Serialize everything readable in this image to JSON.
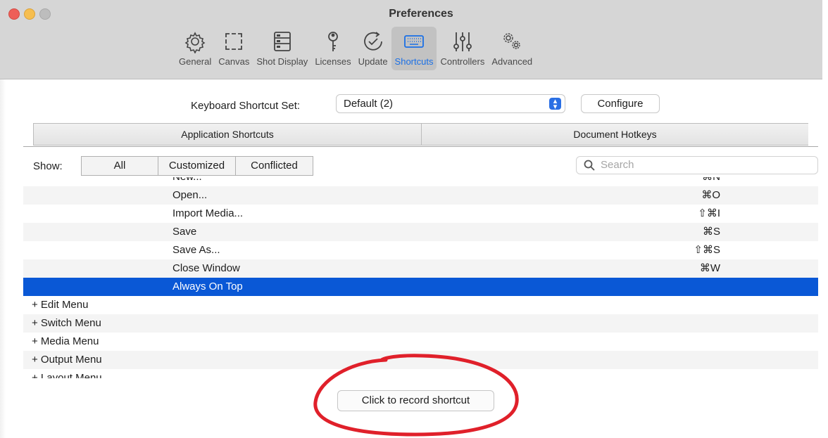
{
  "window": {
    "title": "Preferences"
  },
  "toolbar": {
    "items": [
      {
        "label": "General",
        "icon": "gear-icon"
      },
      {
        "label": "Canvas",
        "icon": "canvas-icon"
      },
      {
        "label": "Shot Display",
        "icon": "shot-display-icon"
      },
      {
        "label": "Licenses",
        "icon": "key-icon"
      },
      {
        "label": "Update",
        "icon": "update-check-icon"
      },
      {
        "label": "Shortcuts",
        "icon": "keyboard-icon",
        "selected": true
      },
      {
        "label": "Controllers",
        "icon": "sliders-icon"
      },
      {
        "label": "Advanced",
        "icon": "gears-icon"
      }
    ]
  },
  "shortcut_set": {
    "label": "Keyboard Shortcut Set:",
    "selected": "Default (2)",
    "configure_label": "Configure"
  },
  "tabs": [
    {
      "label": "Application Shortcuts",
      "selected": true
    },
    {
      "label": "Document Hotkeys",
      "selected": false
    }
  ],
  "filter": {
    "show_label": "Show:",
    "options": [
      "All",
      "Customized",
      "Conflicted"
    ],
    "selected": "All"
  },
  "search": {
    "placeholder": "Search"
  },
  "shortcuts": [
    {
      "name": "New...",
      "key": "⌘N"
    },
    {
      "name": "Open...",
      "key": "⌘O"
    },
    {
      "name": "Import Media...",
      "key": "⇧⌘I"
    },
    {
      "name": "Save",
      "key": "⌘S"
    },
    {
      "name": "Save As...",
      "key": "⇧⌘S"
    },
    {
      "name": "Close Window",
      "key": "⌘W"
    },
    {
      "name": "Always On Top",
      "key": "",
      "selected": true
    }
  ],
  "menus": [
    {
      "name": "+ Edit Menu"
    },
    {
      "name": "+ Switch Menu"
    },
    {
      "name": "+ Media Menu"
    },
    {
      "name": "+ Output Menu"
    },
    {
      "name": "+ Layout Menu"
    }
  ],
  "record_button": {
    "label": "Click to record shortcut"
  },
  "colors": {
    "accent": "#1a6fe6",
    "selection": "#0a58d6",
    "annotation": "#e0202a"
  }
}
